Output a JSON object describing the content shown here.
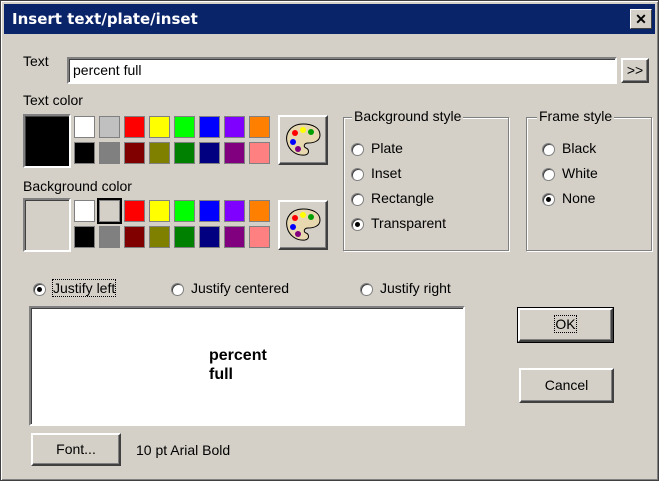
{
  "window": {
    "title": "Insert text/plate/inset",
    "close_glyph": "✕"
  },
  "text_field": {
    "label": "Text",
    "value": "percent full",
    "expand_button": ">>"
  },
  "text_color": {
    "label": "Text color",
    "current": "#000000",
    "top_row": [
      "#ffffff",
      "#c0c0c0",
      "#ff0000",
      "#ffff00",
      "#00ff00",
      "#0000ff",
      "#8000ff",
      "#ff8000"
    ],
    "bottom_row": [
      "#000000",
      "#808080",
      "#800000",
      "#808000",
      "#008000",
      "#000080",
      "#800080",
      "#ff8080"
    ]
  },
  "background_color": {
    "label": "Background color",
    "current": "#d4d0c8",
    "top_row": [
      "#ffffff",
      "#d4d0c8",
      "#ff0000",
      "#ffff00",
      "#00ff00",
      "#0000ff",
      "#8000ff",
      "#ff8000"
    ],
    "bottom_row": [
      "#000000",
      "#808080",
      "#800000",
      "#808000",
      "#008000",
      "#000080",
      "#800080",
      "#ff8080"
    ]
  },
  "background_style": {
    "label": "Background style",
    "options": [
      "Plate",
      "Inset",
      "Rectangle",
      "Transparent"
    ],
    "selected": "Transparent"
  },
  "frame_style": {
    "label": "Frame style",
    "options": [
      "Black",
      "White",
      "None"
    ],
    "selected": "None"
  },
  "justify": {
    "options": [
      "Justify left",
      "Justify centered",
      "Justify right"
    ],
    "selected": "Justify left"
  },
  "preview": {
    "line1": "percent",
    "line2": "full"
  },
  "buttons": {
    "ok": "OK",
    "cancel": "Cancel",
    "font": "Font..."
  },
  "font_description": "10 pt Arial Bold"
}
